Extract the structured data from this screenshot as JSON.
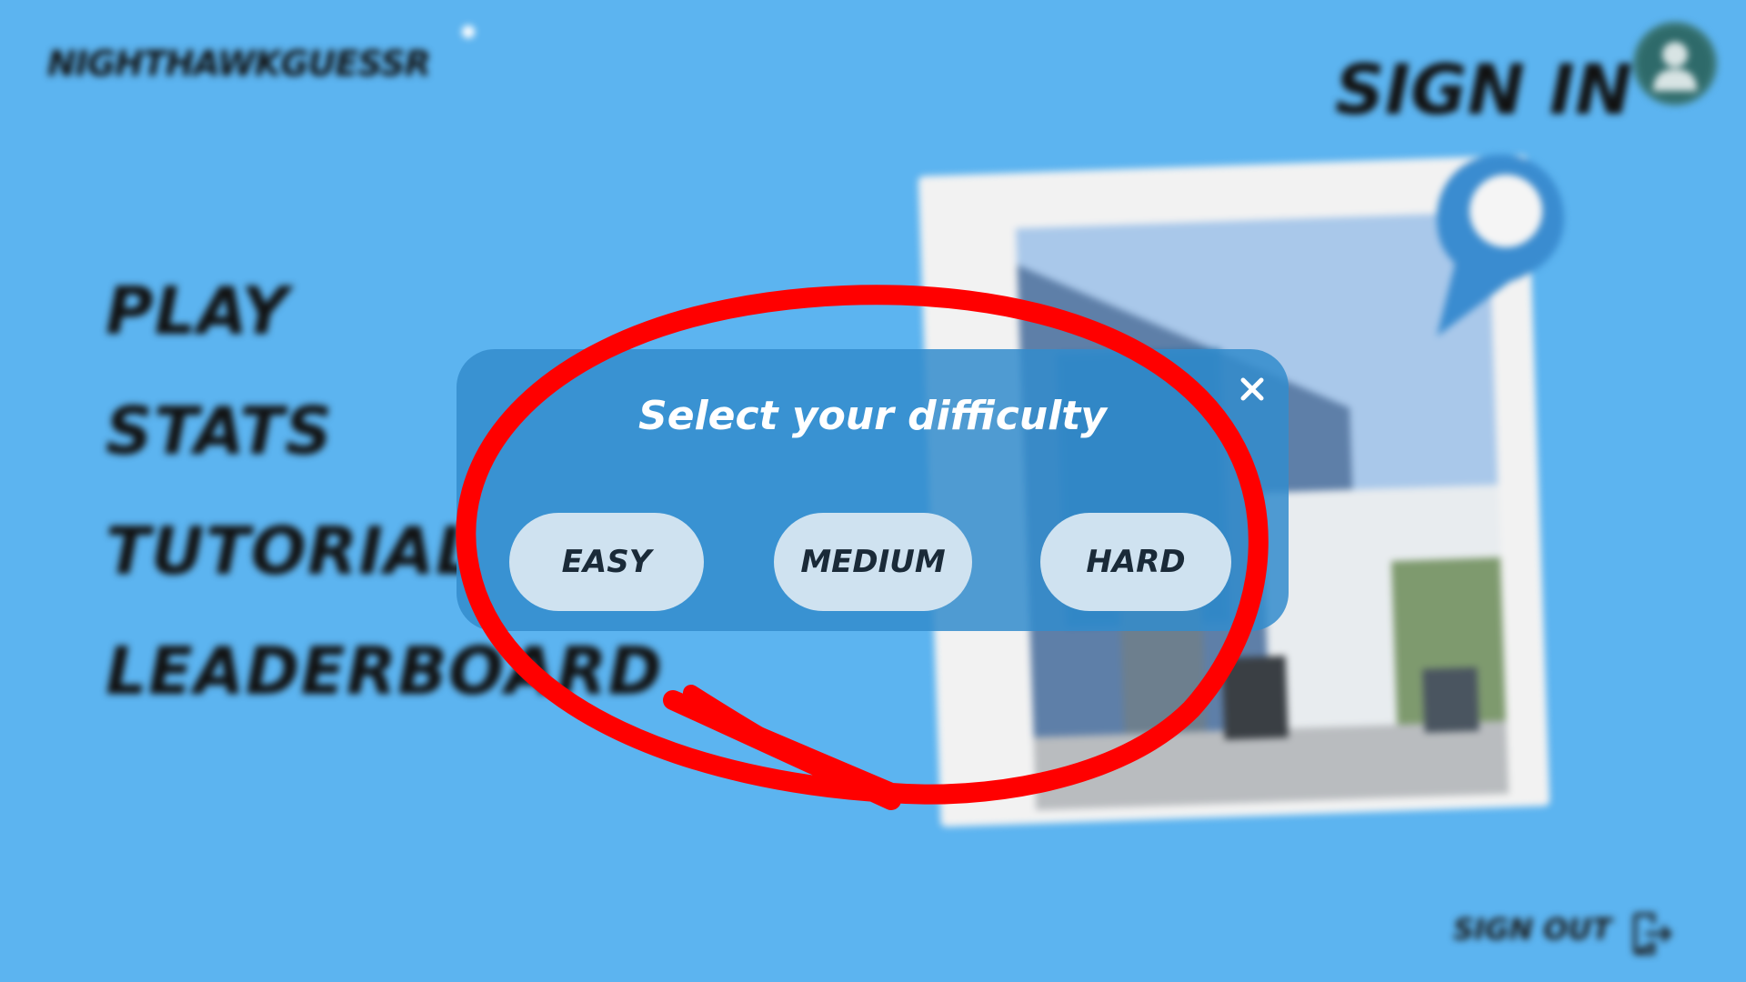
{
  "app": {
    "logo": "NIGHTHAWKGUESSR",
    "sign_in_label": "SIGN IN",
    "sign_out_label": "SIGN OUT"
  },
  "menu": {
    "items": [
      {
        "label": "PLAY"
      },
      {
        "label": "STATS"
      },
      {
        "label": "TUTORIAL"
      },
      {
        "label": "LEADERBOARD"
      }
    ]
  },
  "modal": {
    "title": "Select your difficulty",
    "close_symbol": "×",
    "options": [
      {
        "label": "EASY"
      },
      {
        "label": "MEDIUM"
      },
      {
        "label": "HARD"
      }
    ]
  },
  "colors": {
    "background": "#5cb4f0",
    "modal_background": "#328ccd",
    "button_background": "#cfe2f0",
    "annotation_red": "#ff0000"
  },
  "icons": {
    "avatar": "user-avatar-icon",
    "sign_out": "logout-icon",
    "location_pin": "location-pin-icon",
    "close": "close-icon"
  }
}
